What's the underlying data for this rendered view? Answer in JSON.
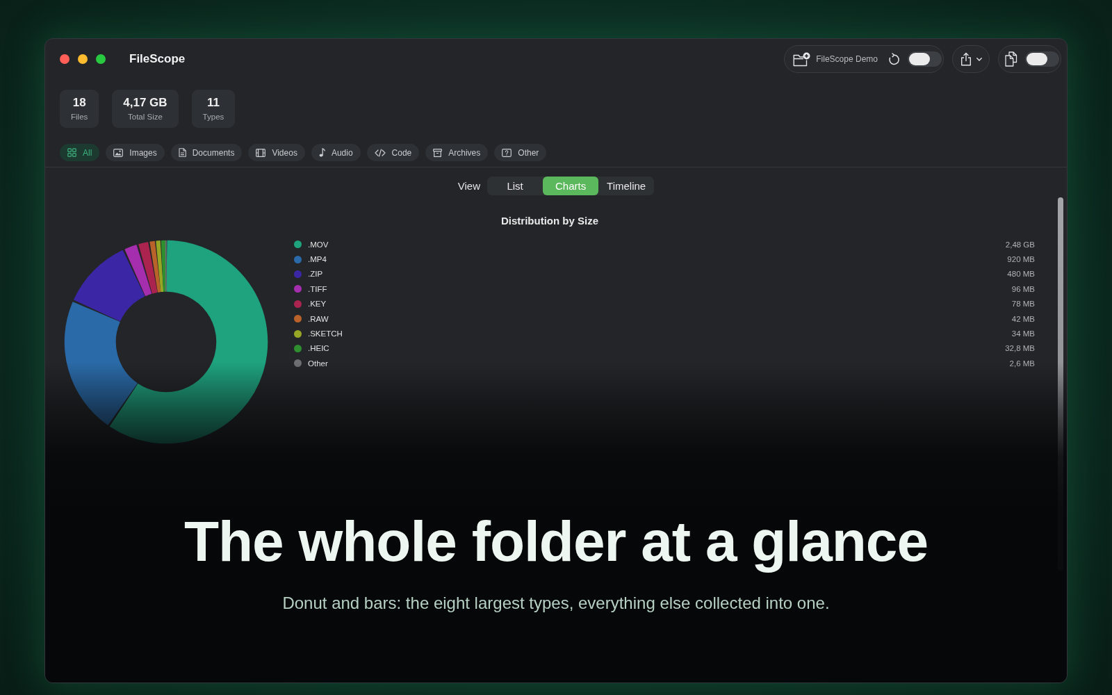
{
  "window": {
    "title": "FileScope"
  },
  "toolbar": {
    "folder_button": {
      "label": "FileScope Demo"
    },
    "toggles": [
      {
        "on": false
      },
      {
        "on": false
      }
    ]
  },
  "stats": [
    {
      "value": "18",
      "label": "Files"
    },
    {
      "value": "4,17 GB",
      "label": "Total Size"
    },
    {
      "value": "11",
      "label": "Types"
    }
  ],
  "filters": [
    {
      "label": "All",
      "selected": true
    },
    {
      "label": "Images",
      "selected": false
    },
    {
      "label": "Documents",
      "selected": false
    },
    {
      "label": "Videos",
      "selected": false
    },
    {
      "label": "Audio",
      "selected": false
    },
    {
      "label": "Code",
      "selected": false
    },
    {
      "label": "Archives",
      "selected": false
    },
    {
      "label": "Other",
      "selected": false
    }
  ],
  "view": {
    "label": "View",
    "options": [
      {
        "label": "List",
        "selected": false
      },
      {
        "label": "Charts",
        "selected": true
      },
      {
        "label": "Timeline",
        "selected": false
      }
    ]
  },
  "distribution": {
    "chart_data": {
      "type": "donut",
      "title": "Distribution by Size",
      "legend": "right",
      "categories": [
        ".MOV",
        ".MP4",
        ".ZIP",
        ".TIFF",
        ".KEY",
        ".RAW",
        ".SKETCH",
        ".HEIC",
        "Other"
      ],
      "values": [
        59.54,
        22.09,
        11.52,
        2.3,
        1.87,
        1.01,
        0.82,
        0.79,
        0.06
      ]
    },
    "legend": [
      {
        "color": "#1fa37f",
        "value": "2,48 GB"
      },
      {
        "color": "#2a6aa8",
        "value": "920 MB"
      },
      {
        "color": "#3b27a6",
        "value": "480 MB"
      },
      {
        "color": "#a42eae",
        "value": "96 MB"
      },
      {
        "color": "#ab2450",
        "value": "78 MB"
      },
      {
        "color": "#b9622a",
        "value": "42 MB"
      },
      {
        "color": "#98a625",
        "value": "34 MB"
      },
      {
        "color": "#2f8e2f",
        "value": "32,8 MB"
      },
      {
        "color": "#6e6f72",
        "value": "2,6 MB"
      }
    ]
  },
  "overlay": {
    "headline": "The whole folder at a glance",
    "subtitle": "Donut and bars: the eight largest types, everything else collected into one."
  }
}
